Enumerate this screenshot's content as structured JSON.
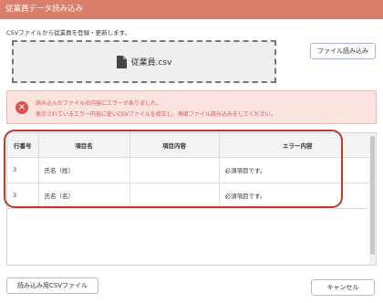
{
  "window": {
    "title": "従業員データ読み込み"
  },
  "instruction": "CSVファイルから従業員を登録・更新します。",
  "dropzone": {
    "file_icon": "file-icon",
    "filename": "従業員.csv"
  },
  "load_button": "ファイル読み込み",
  "error": {
    "icon": "close-circle-icon",
    "line1": "読み込んだファイルの内容にエラーがありました。",
    "line2": "表示されているエラー内容に従いCSVファイルを修正し、再度ファイル読み込みをしてください。"
  },
  "table": {
    "headers": [
      "行番号",
      "項目名",
      "項目内容",
      "エラー内容"
    ],
    "rows": [
      {
        "row": "3",
        "field": "氏名（姓）",
        "value": "",
        "error": "必須項目です。"
      },
      {
        "row": "3",
        "field": "氏名（名）",
        "value": "",
        "error": "必須項目です。"
      }
    ]
  },
  "footer": {
    "csv_button": "読み込み用CSVファイル",
    "cancel_button": "キャンセル"
  },
  "colors": {
    "title_bar": "#d97f6c",
    "error_text": "#d9534f",
    "error_bg": "#fbe3df",
    "highlight": "#c0392b"
  }
}
